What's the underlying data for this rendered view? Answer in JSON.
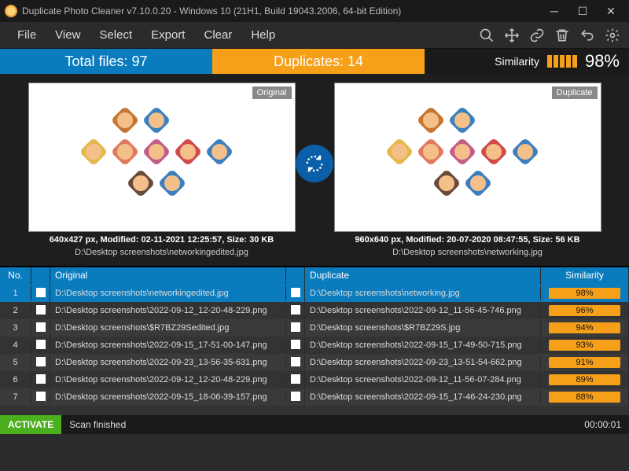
{
  "titlebar": {
    "title": "Duplicate Photo Cleaner v7.10.0.20 - Windows 10 (21H1, Build 19043.2006, 64-bit Edition)"
  },
  "menu": {
    "file": "File",
    "view": "View",
    "select": "Select",
    "export": "Export",
    "clear": "Clear",
    "help": "Help"
  },
  "stats": {
    "total_label": "Total files:",
    "total_value": "97",
    "dup_label": "Duplicates:",
    "dup_value": "14",
    "sim_label": "Similarity",
    "sim_pct": "98%"
  },
  "preview": {
    "original_tag": "Original",
    "duplicate_tag": "Duplicate",
    "orig_meta1": "640x427 px, Modified: 02-11-2021 12:25:57, Size: 30 KB",
    "orig_meta2": "D:\\Desktop screenshots\\networkingedited.jpg",
    "dup_meta1": "960x640 px, Modified: 20-07-2020 08:47:55, Size: 56 KB",
    "dup_meta2": "D:\\Desktop screenshots\\networking.jpg"
  },
  "table": {
    "headers": {
      "no": "No.",
      "original": "Original",
      "duplicate": "Duplicate",
      "similarity": "Similarity"
    },
    "rows": [
      {
        "no": "1",
        "orig": "D:\\Desktop screenshots\\networkingedited.jpg",
        "dup": "D:\\Desktop screenshots\\networking.jpg",
        "sim": "98%"
      },
      {
        "no": "2",
        "orig": "D:\\Desktop screenshots\\2022-09-12_12-20-48-229.png",
        "dup": "D:\\Desktop screenshots\\2022-09-12_11-56-45-746.png",
        "sim": "96%"
      },
      {
        "no": "3",
        "orig": "D:\\Desktop screenshots\\$R7BZ29Sedited.jpg",
        "dup": "D:\\Desktop screenshots\\$R7BZ29S.jpg",
        "sim": "94%"
      },
      {
        "no": "4",
        "orig": "D:\\Desktop screenshots\\2022-09-15_17-51-00-147.png",
        "dup": "D:\\Desktop screenshots\\2022-09-15_17-49-50-715.png",
        "sim": "93%"
      },
      {
        "no": "5",
        "orig": "D:\\Desktop screenshots\\2022-09-23_13-56-35-631.png",
        "dup": "D:\\Desktop screenshots\\2022-09-23_13-51-54-662.png",
        "sim": "91%"
      },
      {
        "no": "6",
        "orig": "D:\\Desktop screenshots\\2022-09-12_12-20-48-229.png",
        "dup": "D:\\Desktop screenshots\\2022-09-12_11-56-07-284.png",
        "sim": "89%"
      },
      {
        "no": "7",
        "orig": "D:\\Desktop screenshots\\2022-09-15_18-06-39-157.png",
        "dup": "D:\\Desktop screenshots\\2022-09-15_17-46-24-230.png",
        "sim": "88%"
      }
    ]
  },
  "statusbar": {
    "activate": "ACTIVATE",
    "status": "Scan finished",
    "time": "00:00:01"
  }
}
